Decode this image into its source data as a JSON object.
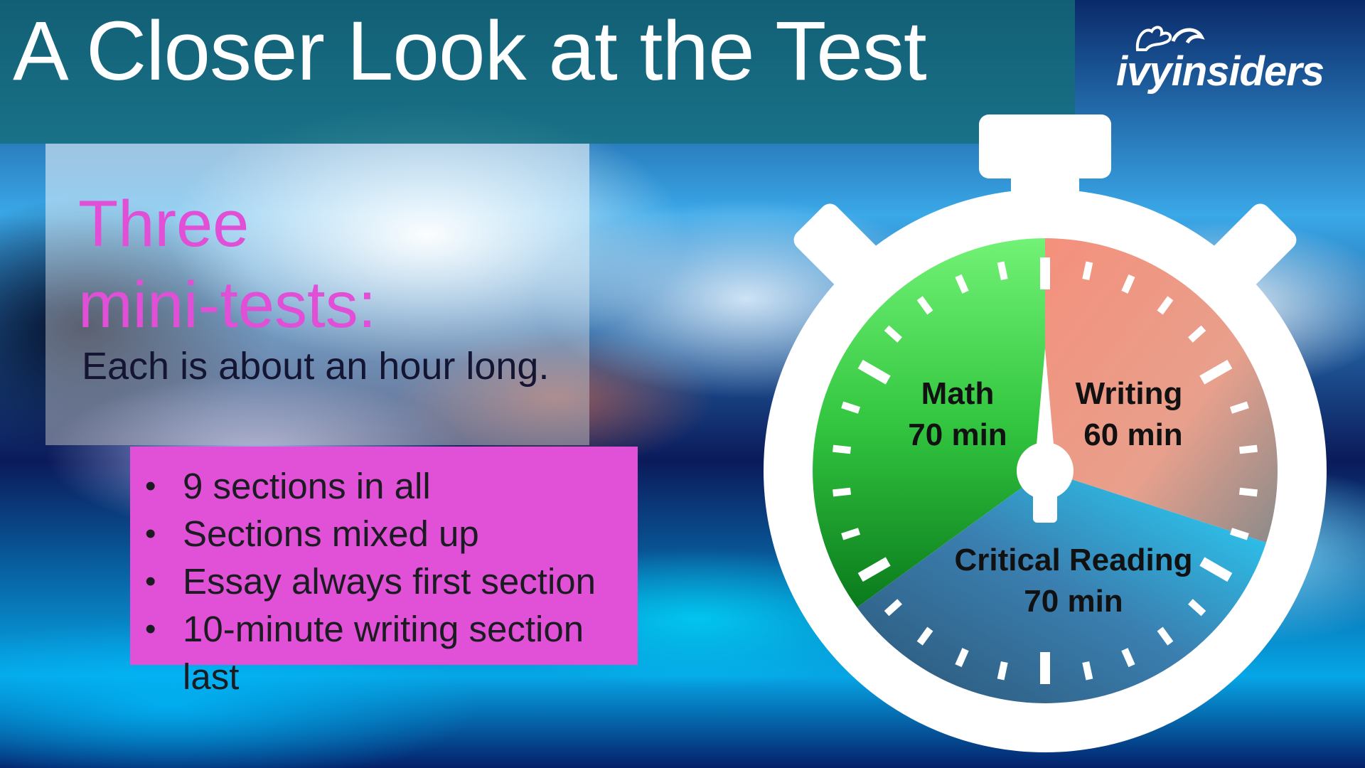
{
  "slide": {
    "title": "A Closer Look at the Test",
    "logo_text": "ivyinsiders",
    "logo_icon": "ivy-leaf-icon"
  },
  "intro": {
    "heading_line1": "Three",
    "heading_line2": "mini-tests:",
    "subtext": "Each is about an hour long."
  },
  "bullets": [
    "9 sections in all",
    "Sections mixed up",
    "Essay always first section",
    "10-minute writing section last"
  ],
  "stopwatch": {
    "icon": "stopwatch-icon",
    "segments": [
      {
        "name": "Math",
        "duration": "70 min",
        "minutes": 70,
        "color": "#3ec84a"
      },
      {
        "name": "Writing",
        "duration": "60 min",
        "minutes": 60,
        "color": "#f3947d"
      },
      {
        "name": "Critical Reading",
        "duration": "70 min",
        "minutes": 70,
        "color": "#2fb6ee"
      }
    ]
  },
  "colors": {
    "accent": "#e151d7",
    "heading": "#e04fd6",
    "title_band": "#146e78"
  }
}
